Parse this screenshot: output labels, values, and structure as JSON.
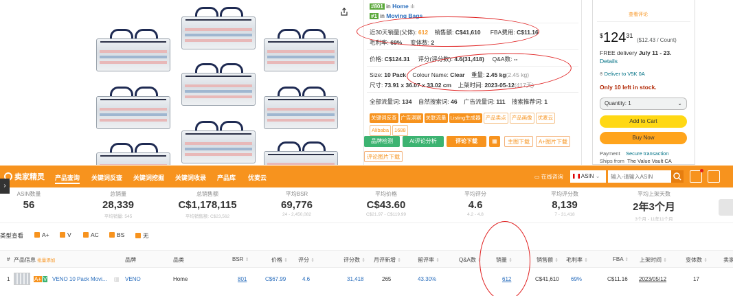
{
  "rank": {
    "primary_badge": "#801",
    "primary_in": "in",
    "primary_cat": "Home",
    "secondary_badge": "#1",
    "secondary_in": "in",
    "secondary_cat": "Moving Bags"
  },
  "metrics": {
    "sales30_label": "近30天销量(父体):",
    "sales30_value": "612",
    "revenue_label": "销售额:",
    "revenue_value": "C$41,610",
    "fba_label": "FBA费用:",
    "fba_value": "C$11.16",
    "margin_label": "毛利率:",
    "margin_value": "69%",
    "variants_label": "变体数:",
    "variants_value": "2"
  },
  "pricing": {
    "price_label": "价格:",
    "price_value": "C$124.31",
    "rating_label": "评分(评分数):",
    "rating_value": "4.6(31,418)",
    "qa_label": "Q&A数:",
    "qa_value": "--"
  },
  "specs": {
    "size_label": "Size:",
    "size_value": "10 Pack",
    "colour_label": "Colour Name:",
    "colour_value": "Clear",
    "weight_label": "重量:",
    "weight_value": "2.45 kg",
    "weight_sub": "(2.45 kg)",
    "dims_label": "尺寸:",
    "dims_value": "73.91 x 36.07 x 33.02 cm",
    "listed_label": "上架时间:",
    "listed_value": "2023-05-12",
    "listed_sub": "(417天)"
  },
  "traffic": {
    "all_label": "全部流量词:",
    "all_value": "134",
    "natural_label": "自然搜索词:",
    "natural_value": "46",
    "ad_label": "广告流量词:",
    "ad_value": "111",
    "rec_label": "搜索推荐词:",
    "rec_value": "1"
  },
  "tags": [
    "关键词反查",
    "广告洞察",
    "关联流量",
    "Listing生成器",
    "产品卖点",
    "产品画像",
    "优麦云",
    "Alibaba",
    "1688"
  ],
  "actions": {
    "brand_check": "品牌检测",
    "ai_review": "AI评论分析",
    "review_download": "评论下载",
    "main_image_download": "主图下载",
    "aplus_download": "A+图片下载",
    "review_image_download": "评论图片下载"
  },
  "buybox": {
    "top_note": "查看评论",
    "price_symbol": "$",
    "price_whole": "124",
    "price_cents": "31",
    "price_unit": "($12.43 / Count)",
    "delivery_prefix": "FREE delivery",
    "delivery_dates": "July 11 - 23.",
    "details": "Details",
    "deliver_to": "Deliver to",
    "deliver_code": "V5K 0A",
    "stock": "Only 10 left in stock.",
    "qty": "Quantity: 1",
    "add_to_cart": "Add to Cart",
    "buy_now": "Buy Now",
    "payment_label": "Payment",
    "payment_value": "Secure transaction",
    "ships_label": "Ships from",
    "ships_value": "The Value Vault CA"
  },
  "toolbar": {
    "logo": "卖家精灵",
    "nav": [
      "产品查询",
      "关键词反查",
      "关键词挖掘",
      "关键词收录",
      "产品库",
      "优麦云"
    ],
    "feedback": "在线咨询",
    "country": "CA",
    "mode": "ASIN",
    "search_placeholder": "输入-请输入ASIN"
  },
  "stats": [
    {
      "label": "ASIN数量",
      "value": "56",
      "sub": ""
    },
    {
      "label": "总销量",
      "value": "28,339",
      "sub": "平均销量: 545"
    },
    {
      "label": "总销售额",
      "value": "C$1,178,115",
      "sub": "平均销售额: C$23,562"
    },
    {
      "label": "平均BSR",
      "value": "69,776",
      "sub": "24 - 2,450,082"
    },
    {
      "label": "平均价格",
      "value": "C$43.60",
      "sub": "C$21.97 - C$119.99"
    },
    {
      "label": "平均评分",
      "value": "4.6",
      "sub": "4.2 - 4.8"
    },
    {
      "label": "平均评分数",
      "value": "8,139",
      "sub": "7 - 31,418"
    },
    {
      "label": "平均上架天数",
      "value": "2年3个月",
      "sub": "3个月 - 11年11个月"
    }
  ],
  "filters": {
    "label": "类型查看",
    "options": [
      "A+",
      "V",
      "AC",
      "BS",
      "无"
    ]
  },
  "table": {
    "headers": [
      "#",
      "产品信息",
      "品牌",
      "品类",
      "BSR",
      "价格",
      "评分",
      "评分数",
      "月评新增",
      "留评率",
      "Q&A数",
      "销量",
      "销售额",
      "毛利率",
      "FBA",
      "上架时间",
      "变体数",
      "卖家"
    ],
    "header_badge": "批量添加",
    "row": {
      "index": "1",
      "badge_a": "A+",
      "badge_v": "V",
      "title": "VENO 10 Pack Movi...",
      "brand": "VENO",
      "category": "Home",
      "bsr": "801",
      "price": "C$67.99",
      "rating": "4.6",
      "ratings": "31,418",
      "monthly_reviews": "265",
      "review_rate": "43.30%",
      "qa": "",
      "sales": "612",
      "revenue": "C$41,610",
      "margin": "69%",
      "fba": "C$11.16",
      "listed": "2023/05/12",
      "variants": "17"
    }
  }
}
